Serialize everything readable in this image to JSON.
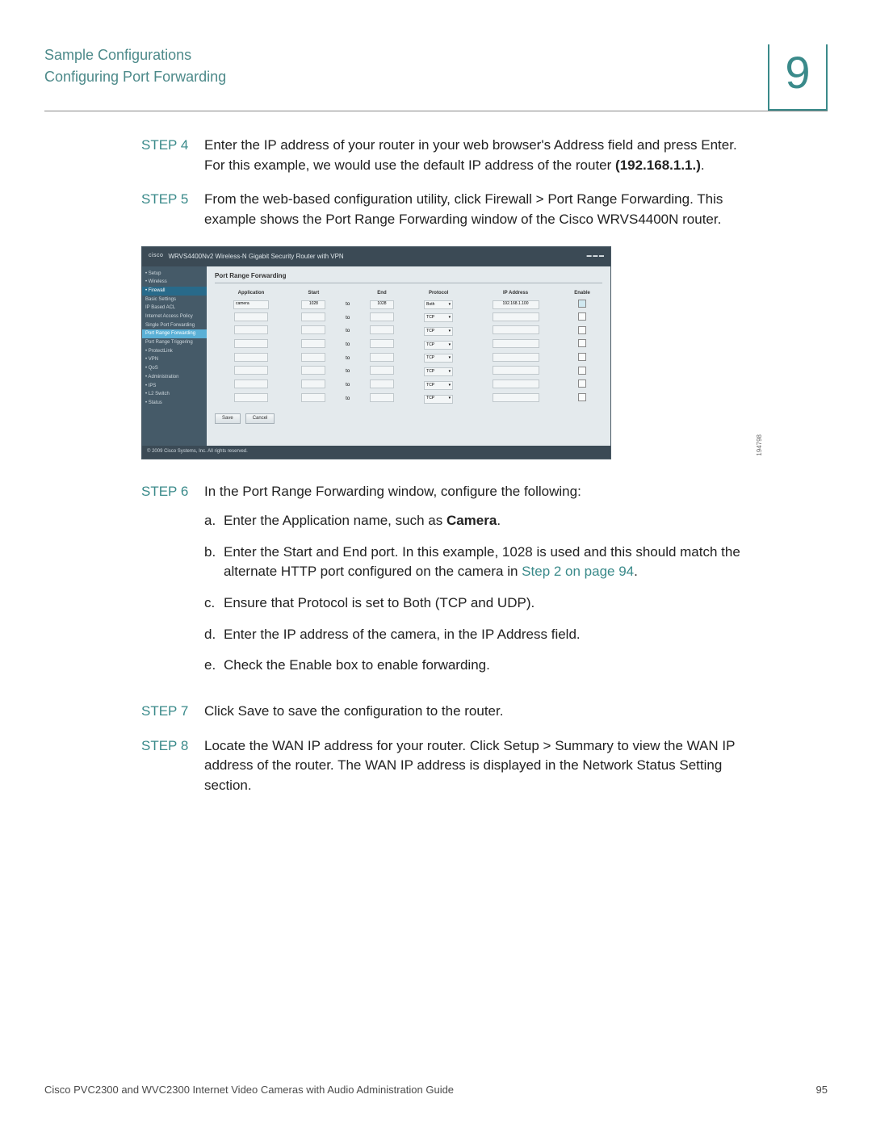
{
  "header": {
    "title": "Sample Configurations",
    "subtitle": "Configuring Port Forwarding",
    "chapter": "9"
  },
  "steps": {
    "s4": {
      "label": "STEP 4",
      "pre": "Enter the IP address of your router in your web browser's Address field and press ",
      "enter": "Enter",
      "mid": ". For this example, we would use the default IP address of the router ",
      "ip": "(192.168.1.1.)",
      "end": "."
    },
    "s5": {
      "label": "STEP 5",
      "pre": "From the web-based configuration utility, click ",
      "path": "Firewall > Port Range Forwarding",
      "post": ". This example shows the Port Range Forwarding window of the Cisco WRVS4400N router."
    },
    "s6": {
      "label": "STEP 6",
      "text": "In the Port Range Forwarding window, configure the following:",
      "a": {
        "letter": "a.",
        "pre": "Enter the Application name, such as ",
        "bold": "Camera",
        "post": "."
      },
      "b": {
        "letter": "b.",
        "pre": "Enter the Start and End port. In this example, ",
        "code": "1028",
        "mid": " is used and this should match the alternate HTTP port configured on the camera in ",
        "link": "Step 2 on page 94",
        "post": "."
      },
      "c": {
        "letter": "c.",
        "pre": "Ensure that Protocol is set to ",
        "code": "Both",
        "post": " (TCP and UDP)."
      },
      "d": {
        "letter": "d.",
        "text": "Enter the IP address of the camera, in the IP Address field."
      },
      "e": {
        "letter": "e.",
        "pre": "Check the ",
        "code": "Enable",
        "post": " box to enable forwarding."
      }
    },
    "s7": {
      "label": "STEP 7",
      "pre": "Click ",
      "save": "Save",
      "post": " to save the configuration to the router."
    },
    "s8": {
      "label": "STEP 8",
      "pre": "Locate the WAN IP address for your router. Click ",
      "path": "Setup > Summary",
      "post": " to view the WAN IP address of the router. The WAN IP address is displayed in the Network Status Setting section."
    }
  },
  "screenshot": {
    "brand": "cisco",
    "product": "WRVS4400Nv2 Wireless-N Gigabit Security Router with VPN",
    "panel_title": "Port Range Forwarding",
    "sidebar": [
      "• Setup",
      "• Wireless",
      "• Firewall",
      "Basic Settings",
      "IP Based ACL",
      "Internet Access Policy",
      "Single Port Forwarding",
      "Port Range Forwarding",
      "Port Range Triggering",
      "• ProtectLink",
      "• VPN",
      "• QoS",
      "• Administration",
      "• IPS",
      "• L2 Switch",
      "• Status"
    ],
    "columns": [
      "Application",
      "Start",
      "",
      "End",
      "Protocol",
      "IP Address",
      "Enable"
    ],
    "to": "to",
    "row0": {
      "app": "camera",
      "start": "1028",
      "end": "1028",
      "proto": "Both",
      "ip": "192.168.1.100"
    },
    "proto_default": "TCP",
    "save": "Save",
    "cancel": "Cancel",
    "copyright": "© 2009 Cisco Systems, Inc. All rights reserved.",
    "side_code": "194798"
  },
  "footer": {
    "left": "Cisco PVC2300 and WVC2300 Internet Video Cameras with Audio Administration Guide",
    "right": "95"
  }
}
